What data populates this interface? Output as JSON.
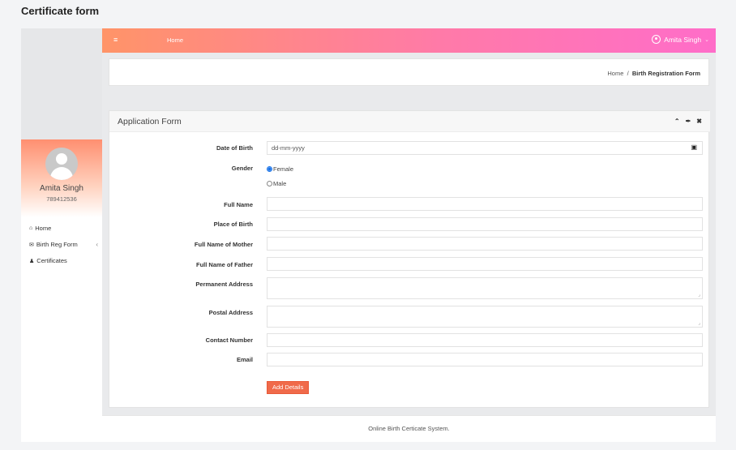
{
  "page": {
    "title": "Certificate form"
  },
  "topbar": {
    "menu_icon": "hamburger-icon",
    "home_label": "Home",
    "user_name": "Amita Singh"
  },
  "profile": {
    "name": "Amita Singh",
    "phone": "789412536"
  },
  "sidebar": {
    "items": [
      {
        "label": "Home",
        "icon": "home-icon"
      },
      {
        "label": "Birth Reg Form",
        "icon": "envelope-icon"
      },
      {
        "label": "Certificates",
        "icon": "user-icon"
      }
    ]
  },
  "breadcrumb": {
    "home": "Home",
    "separator": "/",
    "current": "Birth Registration Form"
  },
  "form": {
    "title": "Application Form",
    "fields": {
      "dob": {
        "label": "Date of Birth",
        "placeholder": "dd-mm-yyyy"
      },
      "gender": {
        "label": "Gender",
        "options": [
          "Female",
          "Male"
        ],
        "selected": "Female"
      },
      "full_name": {
        "label": "Full Name",
        "value": ""
      },
      "place_of_birth": {
        "label": "Place of Birth",
        "value": ""
      },
      "mother_name": {
        "label": "Full Name of Mother",
        "value": ""
      },
      "father_name": {
        "label": "Full Name of Father",
        "value": ""
      },
      "permanent_address": {
        "label": "Permanent Address",
        "value": ""
      },
      "postal_address": {
        "label": "Postal Address",
        "value": ""
      },
      "contact_number": {
        "label": "Contact Number",
        "value": ""
      },
      "email": {
        "label": "Email",
        "value": ""
      }
    },
    "submit_label": "Add Details"
  },
  "footer": {
    "text": "Online Birth Certicate System."
  },
  "colors": {
    "accent_start": "#ff9468",
    "accent_end": "#ff6dc9",
    "button": "#f06a4a"
  }
}
